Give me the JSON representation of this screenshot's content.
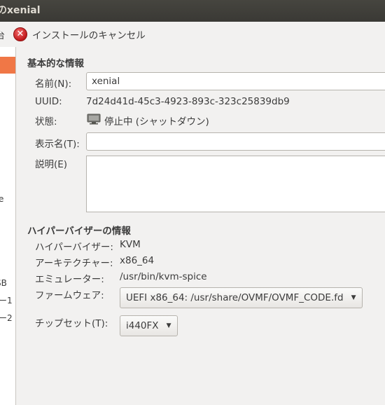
{
  "window": {
    "title": "のxenial"
  },
  "toolbar": {
    "cut_label": "台",
    "cancel_label": "インストールのキャンセル"
  },
  "sidebar": {
    "cut_texts": [
      "e",
      "SB",
      "ー1",
      "ー2"
    ]
  },
  "basic": {
    "title": "基本的な情報",
    "name_label": "名前(N):",
    "name_value": "xenial",
    "uuid_label": "UUID:",
    "uuid_value": "7d24d41d-45c3-4923-893c-323c25839db9",
    "state_label": "状態:",
    "state_value": "停止中 (シャットダウン)",
    "display_name_label": "表示名(T):",
    "display_name_value": "",
    "description_label": "説明(E)",
    "description_value": ""
  },
  "hypervisor": {
    "title": "ハイパーバイザーの情報",
    "hypervisor_label": "ハイパーバイザー:",
    "hypervisor_value": "KVM",
    "arch_label": "アーキテクチャー:",
    "arch_value": "x86_64",
    "emulator_label": "エミュレーター:",
    "emulator_value": "/usr/bin/kvm-spice",
    "firmware_label": "ファームウェア:",
    "firmware_value": "UEFI x86_64: /usr/share/OVMF/OVMF_CODE.fd",
    "chipset_label": "チップセット(T):",
    "chipset_value": "i440FX"
  },
  "icons": {
    "cancel": "cancel-icon",
    "monitor": "monitor-icon",
    "dropdown": "chevron-down-icon"
  },
  "colors": {
    "titlebar": "#3c3b37",
    "selection": "#f07746",
    "cancel_red": "#c7162b"
  }
}
